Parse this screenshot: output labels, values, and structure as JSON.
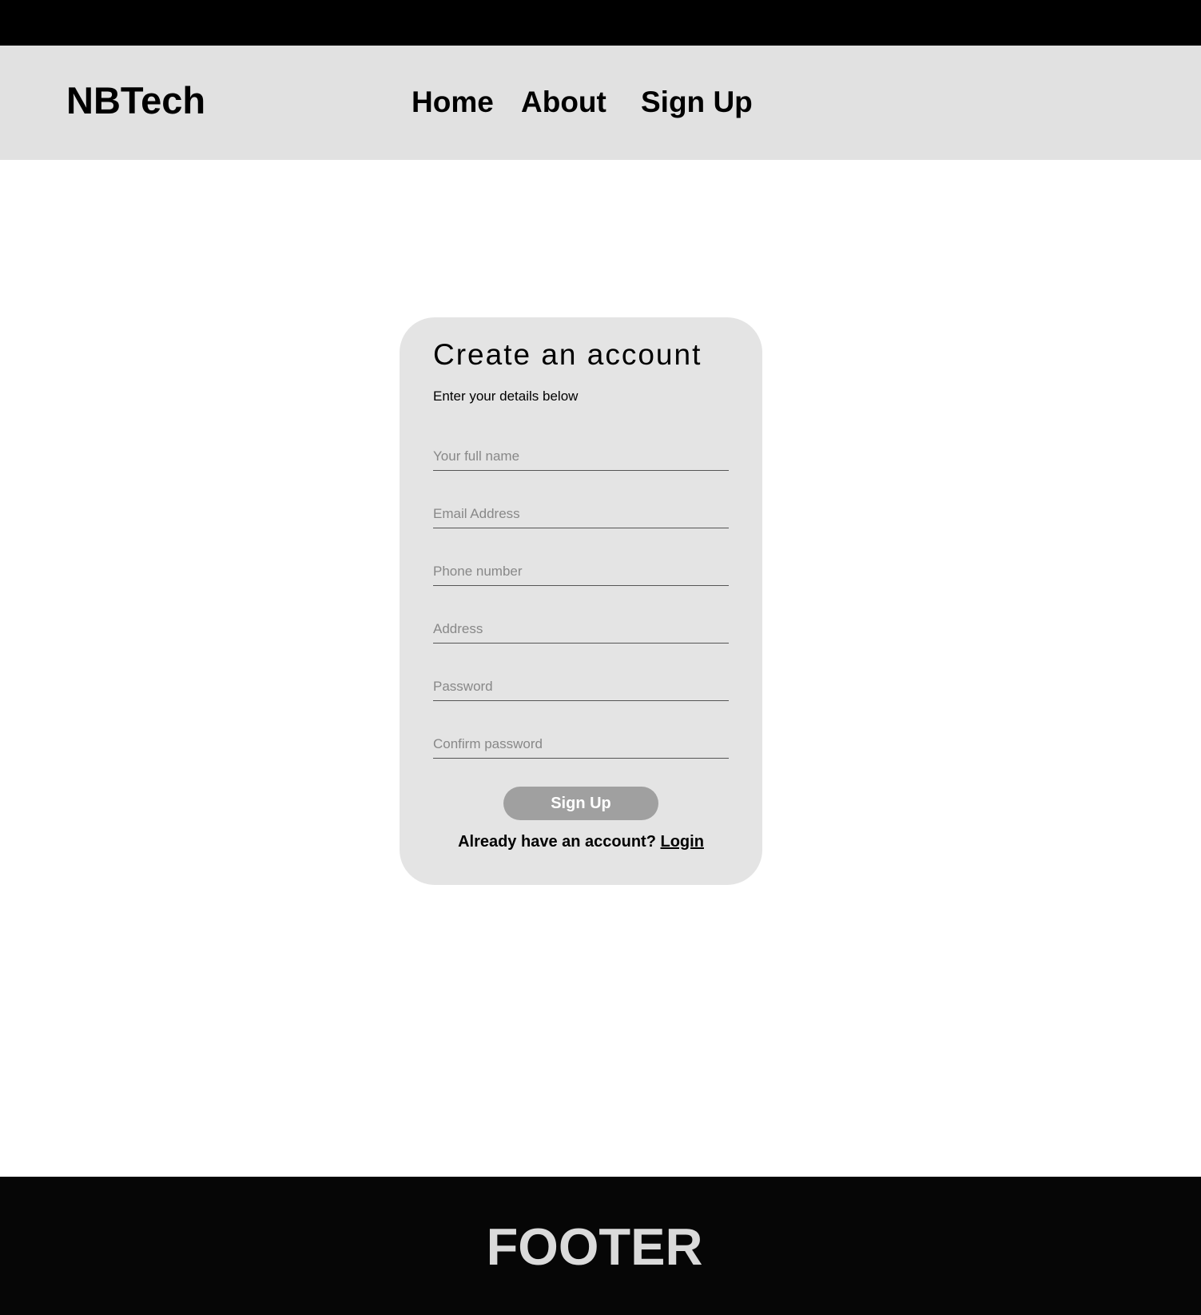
{
  "header": {
    "brand": "NBTech",
    "nav": {
      "home": "Home",
      "about": "About",
      "sign_up": "Sign Up"
    }
  },
  "form": {
    "title": "Create an account",
    "subtitle": "Enter your details below",
    "fields": {
      "full_name": {
        "placeholder": "Your full name",
        "value": ""
      },
      "email": {
        "placeholder": "Email Address",
        "value": ""
      },
      "phone": {
        "placeholder": "Phone number",
        "value": ""
      },
      "address": {
        "placeholder": "Address",
        "value": ""
      },
      "password": {
        "placeholder": "Password",
        "value": ""
      },
      "confirm_password": {
        "placeholder": "Confirm password",
        "value": ""
      }
    },
    "submit_label": "Sign Up",
    "login_prompt": "Already have an account?",
    "login_link": "Login"
  },
  "footer": {
    "text": "FOOTER"
  },
  "colors": {
    "header_bg": "#e1e1e1",
    "card_bg": "#e4e4e4",
    "button_bg": "#a0a0a0",
    "footer_bg": "#060606",
    "top_bar": "#000000"
  }
}
